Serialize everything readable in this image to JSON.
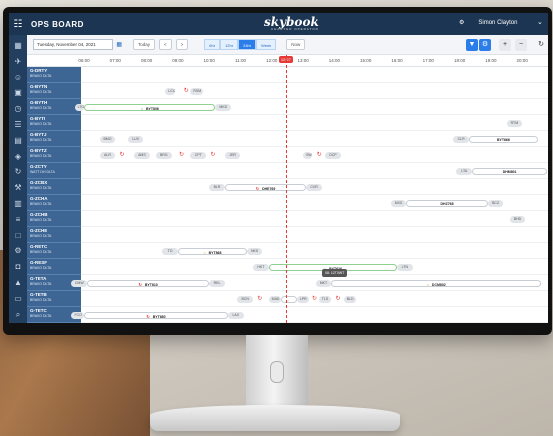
{
  "app": {
    "name": "OPS BOARD",
    "brand": "skybook",
    "brand_sub": "CHARTER OPERATOR",
    "user": "Simon Clayton"
  },
  "toolbar": {
    "date": "Tuesday, November 04, 2021",
    "today_label": "Today",
    "prev_label": "<",
    "next_label": ">",
    "views": [
      "6hr",
      "12hr",
      "24hr",
      "Week"
    ],
    "active_view": "24hr",
    "now_label": "Now",
    "zoom_in": "+",
    "zoom_out": "−"
  },
  "timeline": {
    "ticks": [
      "06:00",
      "07:00",
      "08:00",
      "09:00",
      "10:00",
      "11:00",
      "12:00",
      "13:00",
      "14:00",
      "15:00",
      "16:00",
      "17:00",
      "18:00",
      "19:00",
      "20:00"
    ],
    "now": "12:27"
  },
  "aircraft": [
    {
      "reg": "G-DRTY",
      "sub": "BRAVO    DLTA"
    },
    {
      "reg": "G-BYTN",
      "sub": "BRAVO    DLTA"
    },
    {
      "reg": "G-BYTH",
      "sub": "BRAVO    DLTA"
    },
    {
      "reg": "G-BYTI",
      "sub": "BRAVO    DLTA"
    },
    {
      "reg": "G-BYTJ",
      "sub": "BRAVO    DLTA"
    },
    {
      "reg": "G-BYTZ",
      "sub": "BRAVO    DLTA"
    },
    {
      "reg": "G-ZCTY",
      "sub": "WATT DH  DLTA"
    },
    {
      "reg": "G-ZCBX",
      "sub": "BRAVO    DLTA"
    },
    {
      "reg": "G-ZCHA",
      "sub": "BRAVO    DLTA"
    },
    {
      "reg": "G-ZCHB",
      "sub": "BRAVO    DLTA"
    },
    {
      "reg": "G-ZCHE",
      "sub": "BRAVO    DLTA"
    },
    {
      "reg": "G-RETC",
      "sub": "BRAVO    DLTA"
    },
    {
      "reg": "G-RESF",
      "sub": "BRAVO    DLTA"
    },
    {
      "reg": "G-TETA",
      "sub": "BRAVO    DLTA"
    },
    {
      "reg": "G-TETB",
      "sub": "BRAVO    DLTA"
    },
    {
      "reg": "G-TETC",
      "sub": "BRAVO    DLTA"
    },
    {
      "reg": "G-TETD",
      "sub": "BRAVO    DLTA"
    }
  ],
  "flights": [
    {
      "row": 1,
      "type": "apt",
      "label": "LCC",
      "start": 8.6,
      "end": 8.9
    },
    {
      "row": 1,
      "type": "sync",
      "at": 9.25
    },
    {
      "row": 1,
      "type": "apt",
      "label": "RSM",
      "start": 9.4,
      "end": 9.8
    },
    {
      "row": 2,
      "type": "apt",
      "label": "LTO",
      "start": 5.7,
      "end": 6.0
    },
    {
      "row": 2,
      "type": "flight",
      "label": "BYT806",
      "status": "ok",
      "start": 6.0,
      "end": 10.2
    },
    {
      "row": 2,
      "type": "apt",
      "label": "MKD",
      "start": 10.2,
      "end": 10.7
    },
    {
      "row": 3,
      "type": "apt",
      "label": "RTM",
      "start": 19.5,
      "end": 20.0
    },
    {
      "row": 4,
      "type": "apt",
      "label": "BMO",
      "start": 6.5,
      "end": 7.0
    },
    {
      "row": 4,
      "type": "apt",
      "label": "LUX",
      "start": 7.4,
      "end": 7.9
    },
    {
      "row": 4,
      "type": "apt",
      "label": "CLR",
      "start": 17.8,
      "end": 18.3
    },
    {
      "row": 4,
      "type": "flight",
      "label": "BYT666",
      "status": "none",
      "start": 18.3,
      "end": 20.5
    },
    {
      "row": 5,
      "type": "apt",
      "label": "ALR",
      "start": 6.5,
      "end": 7.0
    },
    {
      "row": 5,
      "type": "sync",
      "at": 7.2
    },
    {
      "row": 5,
      "type": "apt",
      "label": "AMS",
      "start": 7.6,
      "end": 8.1
    },
    {
      "row": 5,
      "type": "apt",
      "label": "BRG",
      "start": 8.3,
      "end": 8.8
    },
    {
      "row": 5,
      "type": "sync",
      "at": 9.1
    },
    {
      "row": 5,
      "type": "apt",
      "label": "CPT",
      "start": 9.4,
      "end": 9.9
    },
    {
      "row": 5,
      "type": "sync",
      "at": 10.1
    },
    {
      "row": 5,
      "type": "apt",
      "label": "JER",
      "start": 10.5,
      "end": 11.0
    },
    {
      "row": 5,
      "type": "apt",
      "label": "SW",
      "start": 13.0,
      "end": 13.3
    },
    {
      "row": 5,
      "type": "sync",
      "at": 13.5
    },
    {
      "row": 5,
      "type": "apt",
      "label": "OCP",
      "start": 13.7,
      "end": 14.2
    },
    {
      "row": 6,
      "type": "apt",
      "label": "LTA",
      "start": 17.9,
      "end": 18.4
    },
    {
      "row": 6,
      "type": "flight",
      "label": "DHM801",
      "status": "none",
      "start": 18.4,
      "end": 20.8
    },
    {
      "row": 7,
      "type": "apt",
      "label": "BLR",
      "start": 10.0,
      "end": 10.5
    },
    {
      "row": 7,
      "type": "flight",
      "label": "DHE769",
      "status": "sync",
      "start": 10.5,
      "end": 13.1
    },
    {
      "row": 7,
      "type": "apt",
      "label": "CVR",
      "start": 13.1,
      "end": 13.6
    },
    {
      "row": 8,
      "type": "apt",
      "label": "MXS",
      "start": 15.8,
      "end": 16.3
    },
    {
      "row": 8,
      "type": "flight",
      "label": "DHZ768",
      "status": "none",
      "start": 16.3,
      "end": 18.9
    },
    {
      "row": 8,
      "type": "apt",
      "label": "BCZ",
      "start": 18.9,
      "end": 19.4
    },
    {
      "row": 9,
      "type": "apt",
      "label": "BHD",
      "start": 19.6,
      "end": 20.1
    },
    {
      "row": 11,
      "type": "apt",
      "label": "TO",
      "start": 8.5,
      "end": 9.0
    },
    {
      "row": 11,
      "type": "flight",
      "label": "BYT868",
      "status": "warn",
      "start": 9.0,
      "end": 11.2
    },
    {
      "row": 11,
      "type": "apt",
      "label": "NKS",
      "start": 11.2,
      "end": 11.7
    },
    {
      "row": 12,
      "type": "apt",
      "label": "HKT",
      "start": 11.4,
      "end": 11.9
    },
    {
      "row": 12,
      "type": "flight",
      "label": "BYT626",
      "status": "ok",
      "start": 11.9,
      "end": 16.0
    },
    {
      "row": 12,
      "type": "apt",
      "label": "LTN",
      "start": 16.0,
      "end": 16.5
    },
    {
      "row": 13,
      "type": "apt",
      "label": "CMW",
      "start": 5.6,
      "end": 6.1
    },
    {
      "row": 13,
      "type": "flight",
      "label": "BYT810",
      "status": "sync",
      "start": 6.1,
      "end": 10.0
    },
    {
      "row": 13,
      "type": "apt",
      "label": "RKL",
      "start": 10.0,
      "end": 10.5
    },
    {
      "row": 13,
      "type": "apt",
      "label": "MKT",
      "start": 13.4,
      "end": 13.9
    },
    {
      "row": 13,
      "type": "flight",
      "label": "DCM802",
      "status": "warn",
      "start": 13.9,
      "end": 20.6
    },
    {
      "row": 14,
      "type": "apt",
      "label": "BCN",
      "start": 10.9,
      "end": 11.4
    },
    {
      "row": 14,
      "type": "sync",
      "at": 11.6
    },
    {
      "row": 14,
      "type": "apt",
      "label": "MAD",
      "start": 11.9,
      "end": 12.3
    },
    {
      "row": 14,
      "type": "flight",
      "label": "",
      "status": "warn",
      "start": 12.3,
      "end": 12.8
    },
    {
      "row": 14,
      "type": "apt",
      "label": "LPR",
      "start": 12.8,
      "end": 13.2
    },
    {
      "row": 14,
      "type": "sync",
      "at": 13.35
    },
    {
      "row": 14,
      "type": "apt",
      "label": "TLS",
      "start": 13.5,
      "end": 13.9
    },
    {
      "row": 14,
      "type": "sync",
      "at": 14.1
    },
    {
      "row": 14,
      "type": "apt",
      "label": "BLD",
      "start": 14.3,
      "end": 14.7
    },
    {
      "row": 15,
      "type": "apt",
      "label": "FCO",
      "start": 5.6,
      "end": 6.0
    },
    {
      "row": 15,
      "type": "flight",
      "label": "BYT680",
      "status": "sync",
      "start": 6.0,
      "end": 10.6
    },
    {
      "row": 15,
      "type": "apt",
      "label": "LAX",
      "start": 10.6,
      "end": 11.1
    },
    {
      "row": 16,
      "type": "apt",
      "label": "FLS",
      "start": 11.2,
      "end": 11.7
    },
    {
      "row": 16,
      "type": "flight",
      "label": "BYT657",
      "status": "none",
      "start": 11.7,
      "end": 15.9
    },
    {
      "row": 16,
      "type": "apt",
      "label": "OLT",
      "start": 15.9,
      "end": 16.3
    }
  ],
  "tooltip": "08: 12T0WT",
  "sidebar_icons": [
    "grid-icon",
    "plane-icon",
    "users-icon",
    "calendar-icon",
    "clock-icon",
    "file-icon",
    "chart-icon",
    "tag-icon",
    "refresh-icon",
    "tool-icon",
    "document-icon",
    "list-icon",
    "box-icon",
    "settings-icon",
    "lock-icon",
    "bell-icon",
    "folder-icon",
    "search-icon"
  ]
}
